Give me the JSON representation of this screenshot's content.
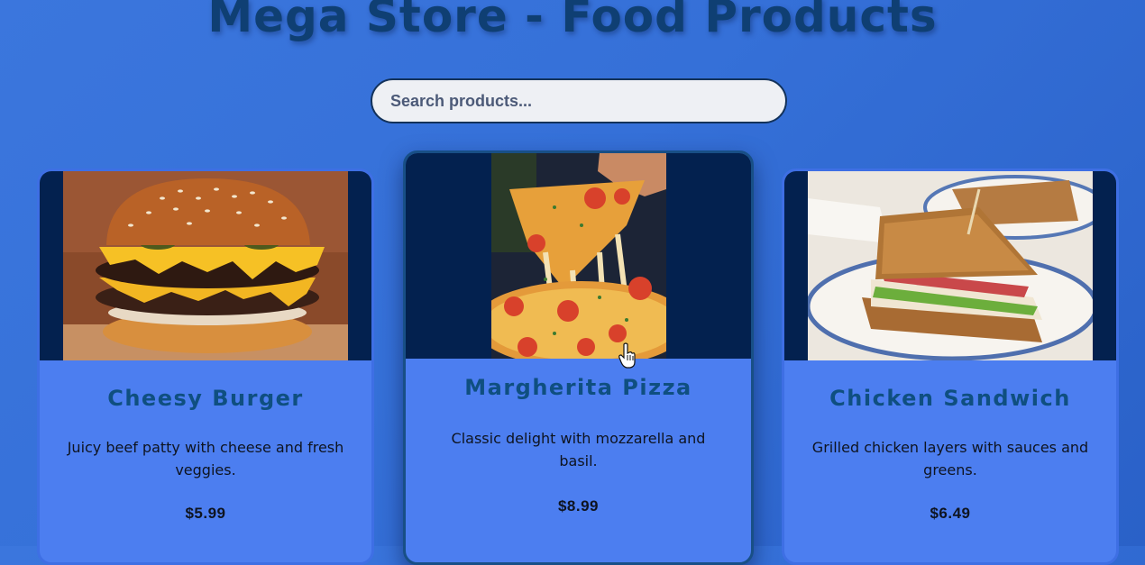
{
  "page": {
    "title": "Mega Store - Food Products"
  },
  "search": {
    "placeholder": "Search products..."
  },
  "products": [
    {
      "name": "Cheesy Burger",
      "description": "Juicy beef patty with cheese and fresh veggies.",
      "price": "$5.99",
      "image_icon": "burger-image"
    },
    {
      "name": "Margherita Pizza",
      "description": "Classic delight with mozzarella and basil.",
      "price": "$8.99",
      "image_icon": "pizza-image"
    },
    {
      "name": "Chicken Sandwich",
      "description": "Grilled chicken layers with sauces and greens.",
      "price": "$6.49",
      "image_icon": "sandwich-image"
    }
  ],
  "colors": {
    "background": "#3570d8",
    "title": "#0f3f73",
    "card": "#4c7ef0",
    "card_name": "#0f4f80",
    "image_backdrop": "#03214f"
  },
  "cursor": {
    "icon": "hand-pointer-icon"
  }
}
